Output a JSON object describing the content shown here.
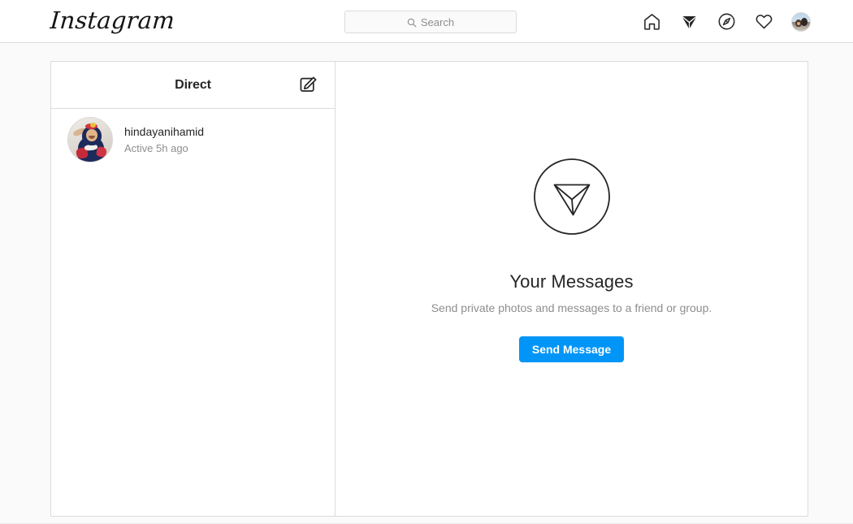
{
  "header": {
    "brand": "Instagram",
    "search": {
      "placeholder": "Search",
      "value": "",
      "icon": "search-icon"
    },
    "nav": [
      {
        "name": "home-icon",
        "label": "Home",
        "active": false
      },
      {
        "name": "direct-icon",
        "label": "Direct",
        "active": true
      },
      {
        "name": "explore-compass-icon",
        "label": "Explore",
        "active": false
      },
      {
        "name": "heart-activity-icon",
        "label": "Activity",
        "active": false
      },
      {
        "name": "profile-avatar",
        "label": "Profile",
        "active": false
      }
    ]
  },
  "sidebar": {
    "title": "Direct",
    "new_message_icon": "new-message-pencil-icon",
    "threads": [
      {
        "username": "hindayanihamid",
        "status": "Active 5h ago"
      }
    ]
  },
  "main": {
    "empty_state": {
      "icon": "direct-circle-icon",
      "title": "Your Messages",
      "subtitle": "Send private photos and messages to a friend or group.",
      "button_label": "Send Message"
    }
  },
  "colors": {
    "accent_blue": "#0095f6",
    "page_background": "#fafafa",
    "card_background": "#ffffff",
    "border": "#dbdbdb",
    "text_primary": "#262626",
    "text_secondary": "#8e8e8e"
  }
}
